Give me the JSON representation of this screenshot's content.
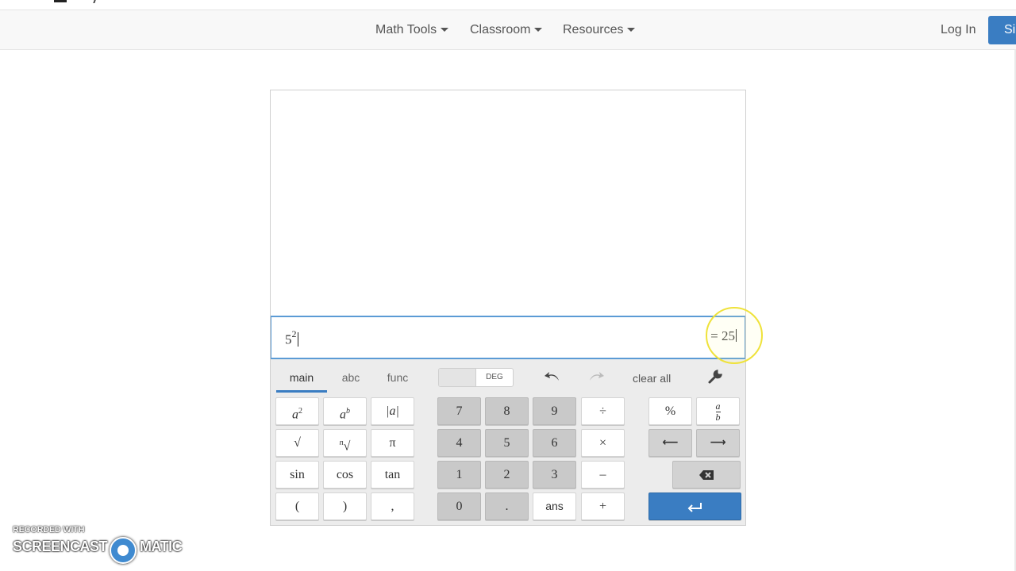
{
  "nav": {
    "math_tools": "Math Tools",
    "classroom": "Classroom",
    "resources": "Resources",
    "login": "Log In",
    "signup": "Si"
  },
  "calculator": {
    "expression_base": "5",
    "expression_exponent": "2",
    "result": "= 25",
    "tabs": [
      "main",
      "abc",
      "func"
    ],
    "active_tab": "main",
    "angle_mode": "DEG",
    "clear_all": "clear all",
    "keys": {
      "a_squared_base": "a",
      "a_squared_exp": "2",
      "a_power_base": "a",
      "a_power_exp": "b",
      "abs": "|a|",
      "sqrt": "√",
      "nthroot_n": "n",
      "nthroot_sym": "√",
      "pi": "π",
      "sin": "sin",
      "cos": "cos",
      "tan": "tan",
      "lparen": "(",
      "rparen": ")",
      "comma": ",",
      "seven": "7",
      "eight": "8",
      "nine": "9",
      "divide": "÷",
      "four": "4",
      "five": "5",
      "six": "6",
      "multiply": "×",
      "one": "1",
      "two": "2",
      "three": "3",
      "minus": "–",
      "zero": "0",
      "dot": ".",
      "ans": "ans",
      "plus": "+",
      "percent": "%",
      "frac_num": "a",
      "frac_den": "b",
      "left_arrow": "⟵",
      "right_arrow": "⟶"
    }
  },
  "watermark": {
    "top": "RECORDED WITH",
    "left": "SCREENCAST",
    "right": "MATIC"
  }
}
